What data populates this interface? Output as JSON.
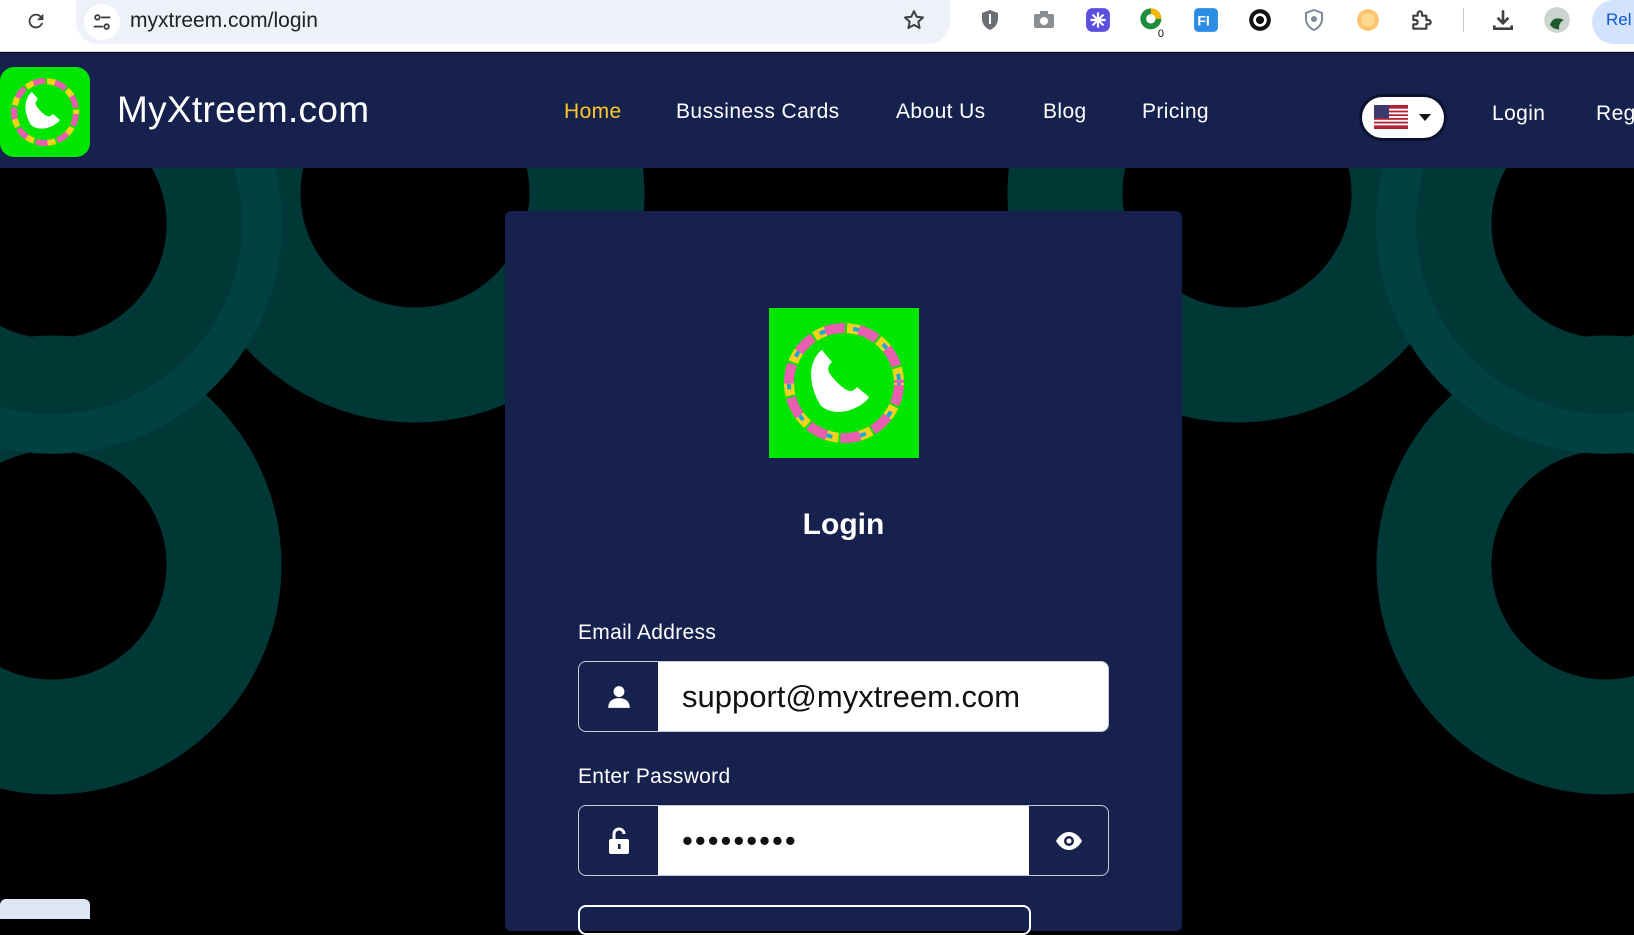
{
  "browser": {
    "url": "myxtreem.com/login",
    "relaunch_label": "Rel",
    "badge_count": "0"
  },
  "navbar": {
    "brand": "MyXtreem.com",
    "links": [
      "Home",
      "Bussiness Cards",
      "About Us",
      "Blog",
      "Pricing"
    ],
    "active_link": "Home",
    "login": "Login",
    "register": "Reg",
    "language_icon": "us-flag-icon"
  },
  "login_form": {
    "title": "Login",
    "email_label": "Email Address",
    "email_value": "support@myxtreem.com",
    "password_label": "Enter Password",
    "password_value": "•••••••••"
  },
  "colors": {
    "navbar_bg": "#17214d",
    "active_link": "#ffc828",
    "logo_green": "#00e600",
    "background_ring": "#003b3b"
  }
}
